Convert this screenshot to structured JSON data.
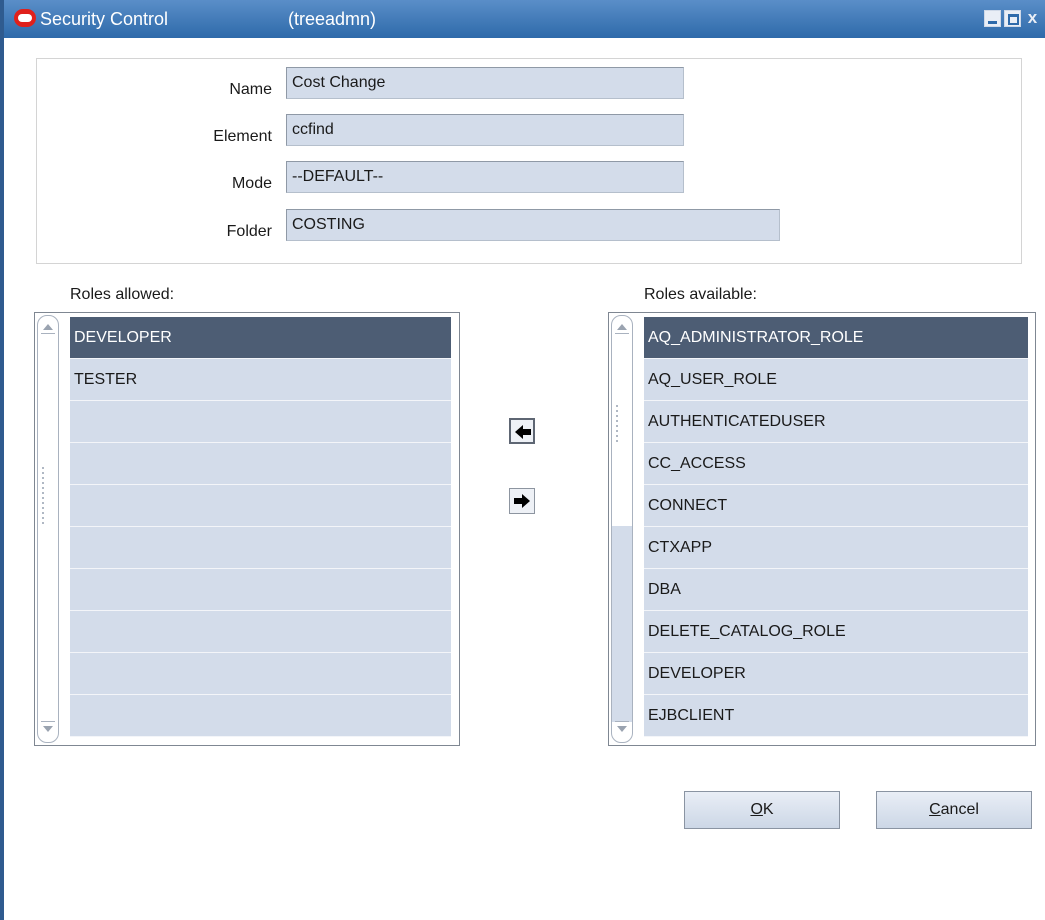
{
  "window": {
    "title": "Security Control",
    "user": "(treeadmn)",
    "controls": {
      "minimize_icon": "minimize-icon",
      "maximize_icon": "maximize-icon",
      "close_icon": "close-icon",
      "close_glyph": "x"
    }
  },
  "form": {
    "name_label": "Name",
    "name_value": "Cost Change",
    "element_label": "Element",
    "element_value": "ccfind",
    "mode_label": "Mode",
    "mode_value": "--DEFAULT--",
    "folder_label": "Folder",
    "folder_value": "COSTING"
  },
  "roles_allowed": {
    "label": "Roles allowed:",
    "items": [
      "DEVELOPER",
      "TESTER",
      "",
      "",
      "",
      "",
      "",
      "",
      "",
      ""
    ],
    "selected_index": 0
  },
  "roles_available": {
    "label": "Roles available:",
    "items": [
      "AQ_ADMINISTRATOR_ROLE",
      "AQ_USER_ROLE",
      "AUTHENTICATEDUSER",
      "CC_ACCESS",
      "CONNECT",
      "CTXAPP",
      "DBA",
      "DELETE_CATALOG_ROLE",
      "DEVELOPER",
      "EJBCLIENT"
    ],
    "selected_index": 0
  },
  "transfer": {
    "add_icon": "arrow-left-icon",
    "remove_icon": "arrow-right-icon"
  },
  "buttons": {
    "ok_mnemonic": "O",
    "ok_rest": "K",
    "cancel_mnemonic": "C",
    "cancel_rest": "ancel"
  },
  "colors": {
    "titlebar": "#2e6aaa",
    "field_bg": "#d3dcea",
    "selected_row": "#4d5d74"
  }
}
